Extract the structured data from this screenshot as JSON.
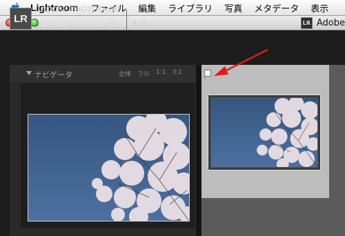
{
  "menubar": {
    "app_name": "Lightroom",
    "items": [
      "ファイル",
      "編集",
      "ライブラリ",
      "写真",
      "メタデータ",
      "表示"
    ]
  },
  "window": {
    "title": "Adobe",
    "lr_badge": "LR"
  },
  "identity": {
    "logo": "LR",
    "brand_top": "ADOBE PHOTOSHOP",
    "brand_main": "LIGHTROOM",
    "version": "1.0"
  },
  "navigator": {
    "title": "ナビゲータ",
    "options": [
      "全体",
      "フル",
      "1:1",
      "3:1"
    ]
  },
  "colors": {
    "sky": "#3d5f8c",
    "blossom": "#e9dde3",
    "arrow": "#e21a1a"
  },
  "icons": [
    "apple-icon",
    "lr-app-icon",
    "disclosure-triangle-icon",
    "flag-icon",
    "annotation-arrow-icon"
  ]
}
